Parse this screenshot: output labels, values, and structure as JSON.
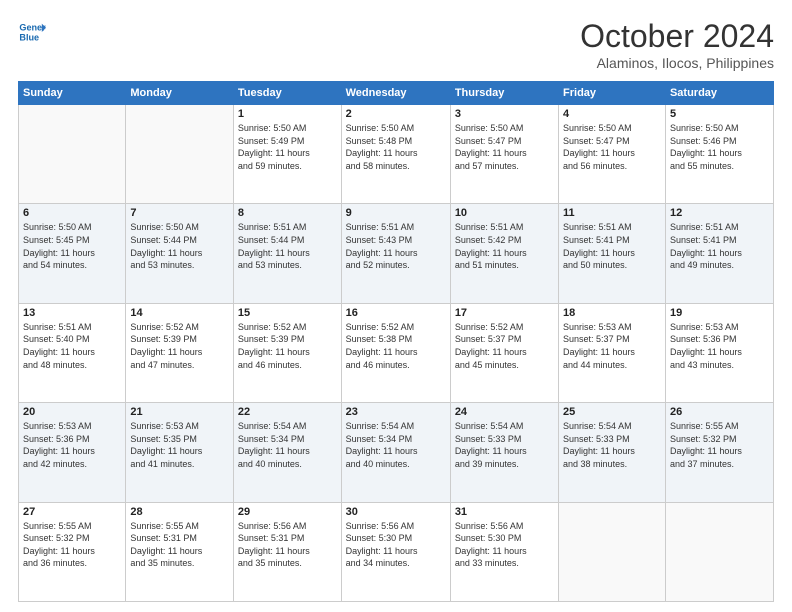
{
  "header": {
    "logo_line1": "General",
    "logo_line2": "Blue",
    "month": "October 2024",
    "location": "Alaminos, Ilocos, Philippines"
  },
  "weekdays": [
    "Sunday",
    "Monday",
    "Tuesday",
    "Wednesday",
    "Thursday",
    "Friday",
    "Saturday"
  ],
  "weeks": [
    [
      {
        "day": "",
        "info": ""
      },
      {
        "day": "",
        "info": ""
      },
      {
        "day": "1",
        "info": "Sunrise: 5:50 AM\nSunset: 5:49 PM\nDaylight: 11 hours\nand 59 minutes."
      },
      {
        "day": "2",
        "info": "Sunrise: 5:50 AM\nSunset: 5:48 PM\nDaylight: 11 hours\nand 58 minutes."
      },
      {
        "day": "3",
        "info": "Sunrise: 5:50 AM\nSunset: 5:47 PM\nDaylight: 11 hours\nand 57 minutes."
      },
      {
        "day": "4",
        "info": "Sunrise: 5:50 AM\nSunset: 5:47 PM\nDaylight: 11 hours\nand 56 minutes."
      },
      {
        "day": "5",
        "info": "Sunrise: 5:50 AM\nSunset: 5:46 PM\nDaylight: 11 hours\nand 55 minutes."
      }
    ],
    [
      {
        "day": "6",
        "info": "Sunrise: 5:50 AM\nSunset: 5:45 PM\nDaylight: 11 hours\nand 54 minutes."
      },
      {
        "day": "7",
        "info": "Sunrise: 5:50 AM\nSunset: 5:44 PM\nDaylight: 11 hours\nand 53 minutes."
      },
      {
        "day": "8",
        "info": "Sunrise: 5:51 AM\nSunset: 5:44 PM\nDaylight: 11 hours\nand 53 minutes."
      },
      {
        "day": "9",
        "info": "Sunrise: 5:51 AM\nSunset: 5:43 PM\nDaylight: 11 hours\nand 52 minutes."
      },
      {
        "day": "10",
        "info": "Sunrise: 5:51 AM\nSunset: 5:42 PM\nDaylight: 11 hours\nand 51 minutes."
      },
      {
        "day": "11",
        "info": "Sunrise: 5:51 AM\nSunset: 5:41 PM\nDaylight: 11 hours\nand 50 minutes."
      },
      {
        "day": "12",
        "info": "Sunrise: 5:51 AM\nSunset: 5:41 PM\nDaylight: 11 hours\nand 49 minutes."
      }
    ],
    [
      {
        "day": "13",
        "info": "Sunrise: 5:51 AM\nSunset: 5:40 PM\nDaylight: 11 hours\nand 48 minutes."
      },
      {
        "day": "14",
        "info": "Sunrise: 5:52 AM\nSunset: 5:39 PM\nDaylight: 11 hours\nand 47 minutes."
      },
      {
        "day": "15",
        "info": "Sunrise: 5:52 AM\nSunset: 5:39 PM\nDaylight: 11 hours\nand 46 minutes."
      },
      {
        "day": "16",
        "info": "Sunrise: 5:52 AM\nSunset: 5:38 PM\nDaylight: 11 hours\nand 46 minutes."
      },
      {
        "day": "17",
        "info": "Sunrise: 5:52 AM\nSunset: 5:37 PM\nDaylight: 11 hours\nand 45 minutes."
      },
      {
        "day": "18",
        "info": "Sunrise: 5:53 AM\nSunset: 5:37 PM\nDaylight: 11 hours\nand 44 minutes."
      },
      {
        "day": "19",
        "info": "Sunrise: 5:53 AM\nSunset: 5:36 PM\nDaylight: 11 hours\nand 43 minutes."
      }
    ],
    [
      {
        "day": "20",
        "info": "Sunrise: 5:53 AM\nSunset: 5:36 PM\nDaylight: 11 hours\nand 42 minutes."
      },
      {
        "day": "21",
        "info": "Sunrise: 5:53 AM\nSunset: 5:35 PM\nDaylight: 11 hours\nand 41 minutes."
      },
      {
        "day": "22",
        "info": "Sunrise: 5:54 AM\nSunset: 5:34 PM\nDaylight: 11 hours\nand 40 minutes."
      },
      {
        "day": "23",
        "info": "Sunrise: 5:54 AM\nSunset: 5:34 PM\nDaylight: 11 hours\nand 40 minutes."
      },
      {
        "day": "24",
        "info": "Sunrise: 5:54 AM\nSunset: 5:33 PM\nDaylight: 11 hours\nand 39 minutes."
      },
      {
        "day": "25",
        "info": "Sunrise: 5:54 AM\nSunset: 5:33 PM\nDaylight: 11 hours\nand 38 minutes."
      },
      {
        "day": "26",
        "info": "Sunrise: 5:55 AM\nSunset: 5:32 PM\nDaylight: 11 hours\nand 37 minutes."
      }
    ],
    [
      {
        "day": "27",
        "info": "Sunrise: 5:55 AM\nSunset: 5:32 PM\nDaylight: 11 hours\nand 36 minutes."
      },
      {
        "day": "28",
        "info": "Sunrise: 5:55 AM\nSunset: 5:31 PM\nDaylight: 11 hours\nand 35 minutes."
      },
      {
        "day": "29",
        "info": "Sunrise: 5:56 AM\nSunset: 5:31 PM\nDaylight: 11 hours\nand 35 minutes."
      },
      {
        "day": "30",
        "info": "Sunrise: 5:56 AM\nSunset: 5:30 PM\nDaylight: 11 hours\nand 34 minutes."
      },
      {
        "day": "31",
        "info": "Sunrise: 5:56 AM\nSunset: 5:30 PM\nDaylight: 11 hours\nand 33 minutes."
      },
      {
        "day": "",
        "info": ""
      },
      {
        "day": "",
        "info": ""
      }
    ]
  ]
}
